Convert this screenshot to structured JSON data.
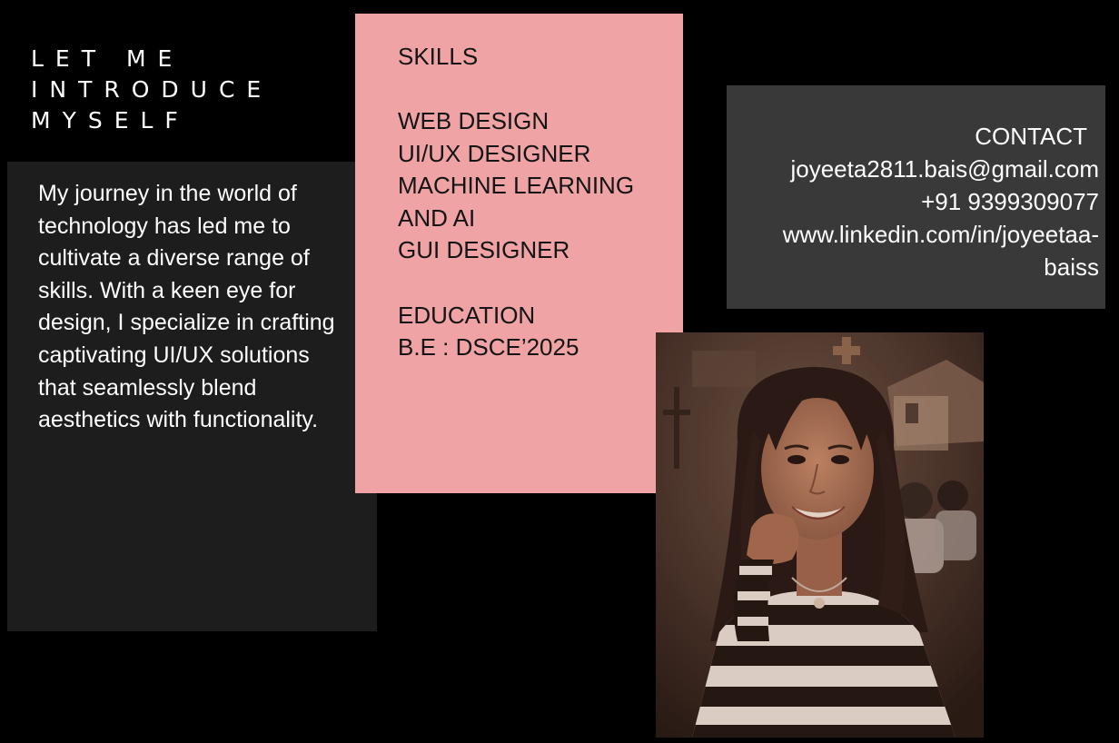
{
  "intro": {
    "heading_lines": [
      "LET ME",
      "INTRODUCE",
      "MYSELF"
    ]
  },
  "about": {
    "text": "My journey in the world of technology has led me to cultivate a diverse range of skills. With a keen eye for design, I specialize in crafting captivating UI/UX solutions that seamlessly blend aesthetics with functionality."
  },
  "skills": {
    "heading": "SKILLS",
    "items": [
      "WEB DESIGN",
      "UI/UX DESIGNER",
      "MACHINE LEARNING",
      "AND AI",
      "GUI DESIGNER"
    ]
  },
  "education": {
    "heading": "EDUCATION",
    "value": "B.E : DSCE’2025"
  },
  "contact": {
    "heading": "CONTACT",
    "email": "joyeeta2811.bais@gmail.com",
    "phone": "+91 9399309077",
    "linkedin_line1": "www.linkedin.com/in/joyeetaa-",
    "linkedin_line2": "baiss"
  },
  "colors": {
    "background": "#000000",
    "about_card": "#1d1d1d",
    "skills_card": "#f0a3a5",
    "contact_card": "#393939"
  }
}
